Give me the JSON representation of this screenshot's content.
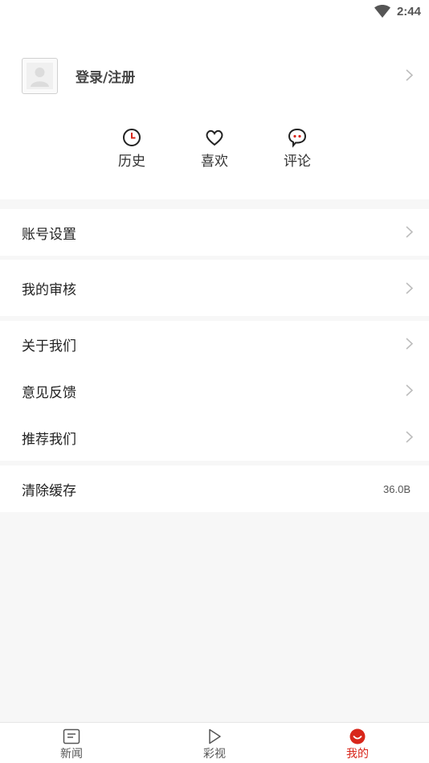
{
  "status_bar": {
    "time": "2:44"
  },
  "profile": {
    "login_label": "登录/注册"
  },
  "quick_actions": [
    {
      "label": "历史",
      "icon": "clock-icon"
    },
    {
      "label": "喜欢",
      "icon": "heart-icon"
    },
    {
      "label": "评论",
      "icon": "comment-icon"
    }
  ],
  "menu": {
    "account_settings": "账号设置",
    "my_review": "我的审核",
    "about_us": "关于我们",
    "feedback": "意见反馈",
    "recommend_us": "推荐我们",
    "clear_cache": "清除缓存",
    "cache_size": "36.0B"
  },
  "bottom_nav": {
    "tabs": [
      {
        "label": "新闻",
        "icon": "news-icon"
      },
      {
        "label": "彩视",
        "icon": "play-icon"
      },
      {
        "label": "我的",
        "icon": "profile-smile-icon",
        "active": true
      }
    ]
  },
  "colors": {
    "accent": "#d8261a",
    "background": "#f7f7f7"
  }
}
